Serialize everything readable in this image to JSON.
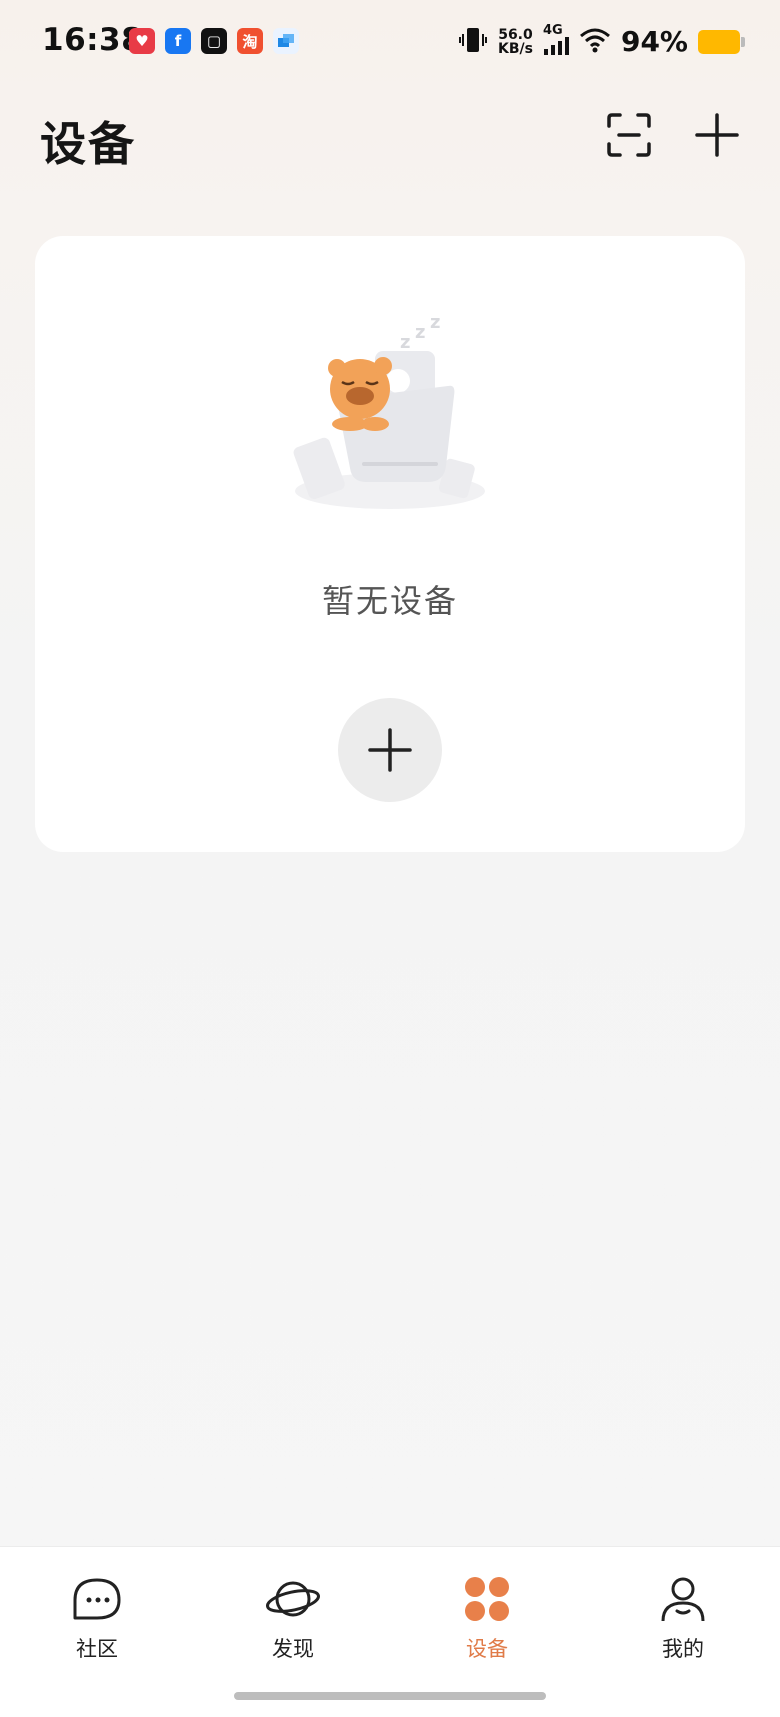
{
  "status_bar": {
    "time": "16:38",
    "speed_value": "56.0",
    "speed_unit": "KB/s",
    "network": "4G",
    "battery": "94%",
    "notification_icons": [
      "pinduoduo-icon",
      "facebook-icon",
      "video-app-icon",
      "taobao-icon",
      "message-app-icon"
    ]
  },
  "header": {
    "title": "设备",
    "scan_icon": "scan-icon",
    "add_icon": "plus-icon"
  },
  "empty_state": {
    "message": "暂无设备",
    "add_icon": "plus-icon"
  },
  "bottom_nav": {
    "items": [
      {
        "label": "社区",
        "icon": "chat-bubble-icon",
        "active": false
      },
      {
        "label": "发现",
        "icon": "planet-icon",
        "active": false
      },
      {
        "label": "设备",
        "icon": "devices-grid-icon",
        "active": true
      },
      {
        "label": "我的",
        "icon": "person-icon",
        "active": false
      }
    ]
  },
  "colors": {
    "accent": "#e07b48",
    "card_bg": "#ffffff",
    "add_circle_bg": "#ececec",
    "battery": "#ffb800"
  }
}
